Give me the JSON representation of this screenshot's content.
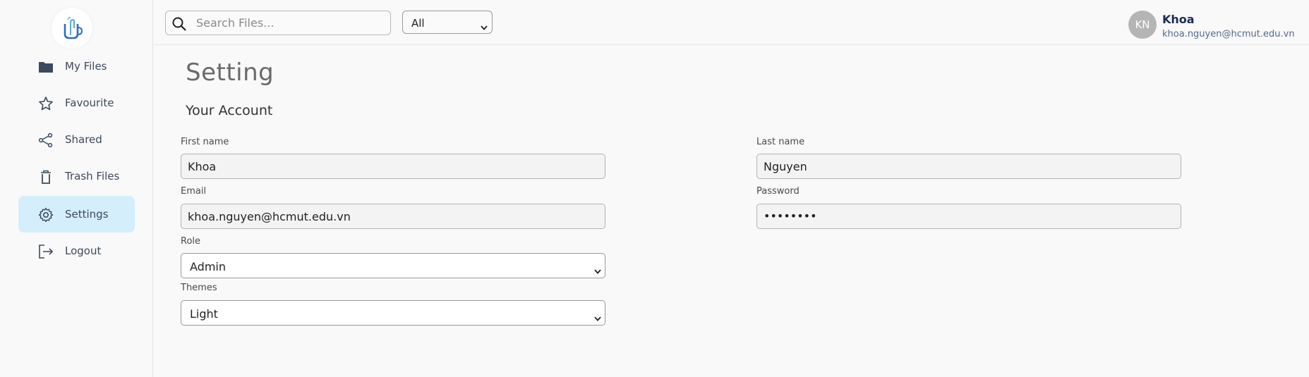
{
  "sidebar": {
    "items": [
      {
        "label": "My Files",
        "icon": "folder-icon"
      },
      {
        "label": "Favourite",
        "icon": "star-icon"
      },
      {
        "label": "Shared",
        "icon": "share-icon"
      },
      {
        "label": "Trash Files",
        "icon": "trash-icon"
      },
      {
        "label": "Settings",
        "icon": "gear-icon",
        "active": true
      },
      {
        "label": "Logout",
        "icon": "logout-icon"
      }
    ]
  },
  "topbar": {
    "search_placeholder": "Search Files...",
    "filter_value": "All"
  },
  "user": {
    "initials": "KN",
    "name": "Khoa",
    "email": "khoa.nguyen@hcmut.edu.vn"
  },
  "main": {
    "title": "Setting",
    "section_title": "Your Account",
    "fields": {
      "first_name": {
        "label": "First name",
        "value": "Khoa"
      },
      "last_name": {
        "label": "Last name",
        "value": "Nguyen"
      },
      "email": {
        "label": "Email",
        "value": "khoa.nguyen@hcmut.edu.vn"
      },
      "password": {
        "label": "Password",
        "value": "••••••••"
      },
      "role": {
        "label": "Role",
        "value": "Admin"
      },
      "themes": {
        "label": "Themes",
        "value": "Light"
      }
    }
  },
  "colors": {
    "active_nav_bg": "#d4eefb",
    "avatar_bg": "#b5b5b5",
    "user_name": "#1c2b56"
  }
}
